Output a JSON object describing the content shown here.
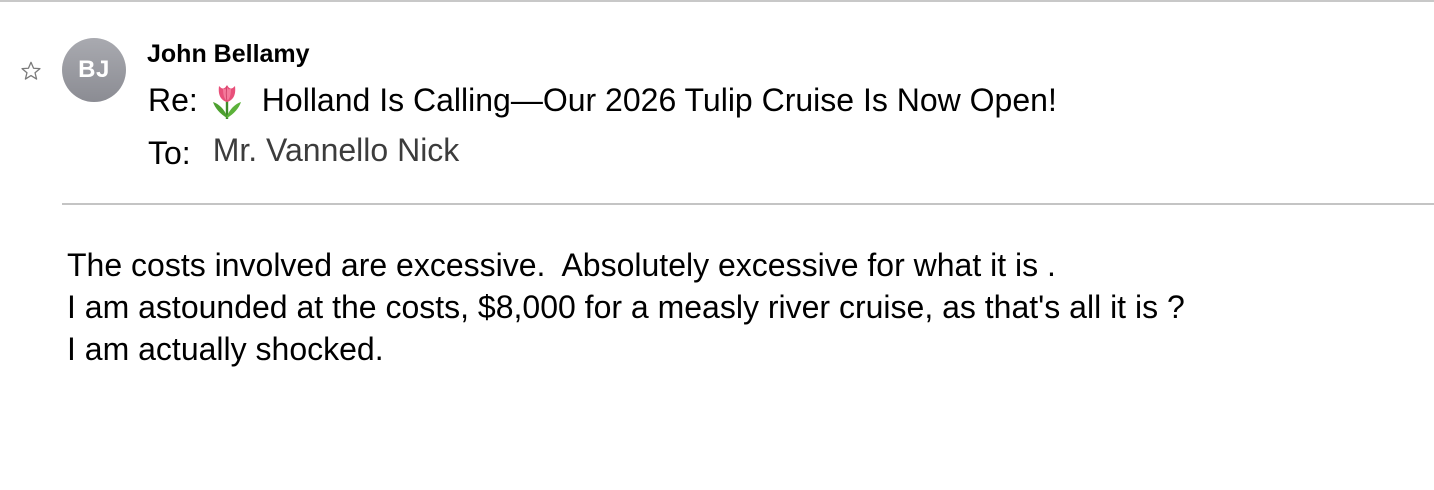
{
  "message": {
    "sender_name": "John Bellamy",
    "avatar_initials": "BJ",
    "subject_prefix": "Re:",
    "subject_icon": "tulip-emoji",
    "subject_text": "Holland Is Calling—Our 2026 Tulip Cruise Is Now Open!",
    "to_label": "To:",
    "to_value": "Mr. Vannello Nick",
    "star_icon": "star-outline-icon"
  },
  "body": {
    "line1": "The costs involved are excessive.  Absolutely excessive for what it is .",
    "line2": "I am astounded at the costs, $8,000 for a measly river cruise, as that's all it is ?",
    "line3": "I am actually shocked."
  },
  "colors": {
    "avatar_bg": "#9a9ba1",
    "divider": "#c4c4c4",
    "recipient_text": "#3c3c3c"
  }
}
